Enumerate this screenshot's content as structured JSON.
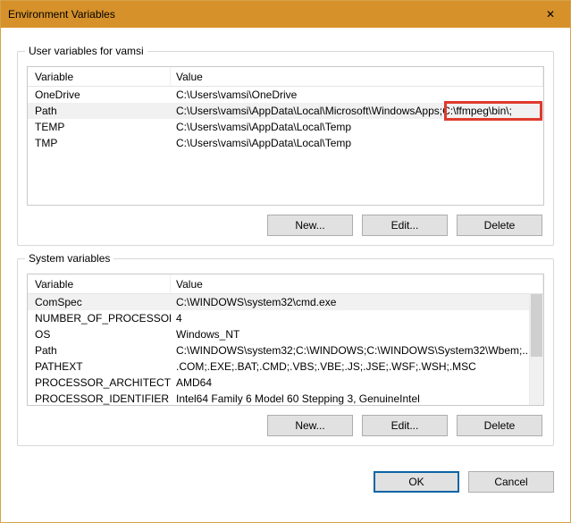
{
  "window": {
    "title": "Environment Variables"
  },
  "icons": {
    "close": "✕"
  },
  "user_section": {
    "legend": "User variables for vamsi",
    "header_variable": "Variable",
    "header_value": "Value",
    "rows": [
      {
        "name": "OneDrive",
        "value": "C:\\Users\\vamsi\\OneDrive"
      },
      {
        "name": "Path",
        "value": "C:\\Users\\vamsi\\AppData\\Local\\Microsoft\\WindowsApps;C:\\ffmpeg\\bin\\;"
      },
      {
        "name": "TEMP",
        "value": "C:\\Users\\vamsi\\AppData\\Local\\Temp"
      },
      {
        "name": "TMP",
        "value": "C:\\Users\\vamsi\\AppData\\Local\\Temp"
      }
    ],
    "buttons": {
      "new": "New...",
      "edit": "Edit...",
      "delete": "Delete"
    }
  },
  "system_section": {
    "legend": "System variables",
    "header_variable": "Variable",
    "header_value": "Value",
    "rows": [
      {
        "name": "ComSpec",
        "value": "C:\\WINDOWS\\system32\\cmd.exe"
      },
      {
        "name": "NUMBER_OF_PROCESSORS",
        "value": "4"
      },
      {
        "name": "OS",
        "value": "Windows_NT"
      },
      {
        "name": "Path",
        "value": "C:\\WINDOWS\\system32;C:\\WINDOWS;C:\\WINDOWS\\System32\\Wbem;..."
      },
      {
        "name": "PATHEXT",
        "value": ".COM;.EXE;.BAT;.CMD;.VBS;.VBE;.JS;.JSE;.WSF;.WSH;.MSC"
      },
      {
        "name": "PROCESSOR_ARCHITECTURE",
        "value": "AMD64"
      },
      {
        "name": "PROCESSOR_IDENTIFIER",
        "value": "Intel64 Family 6 Model 60 Stepping 3, GenuineIntel"
      }
    ],
    "buttons": {
      "new": "New...",
      "edit": "Edit...",
      "delete": "Delete"
    }
  },
  "dialog_buttons": {
    "ok": "OK",
    "cancel": "Cancel"
  },
  "highlight": {
    "text": "C:\\ffmpeg\\bin\\;"
  }
}
